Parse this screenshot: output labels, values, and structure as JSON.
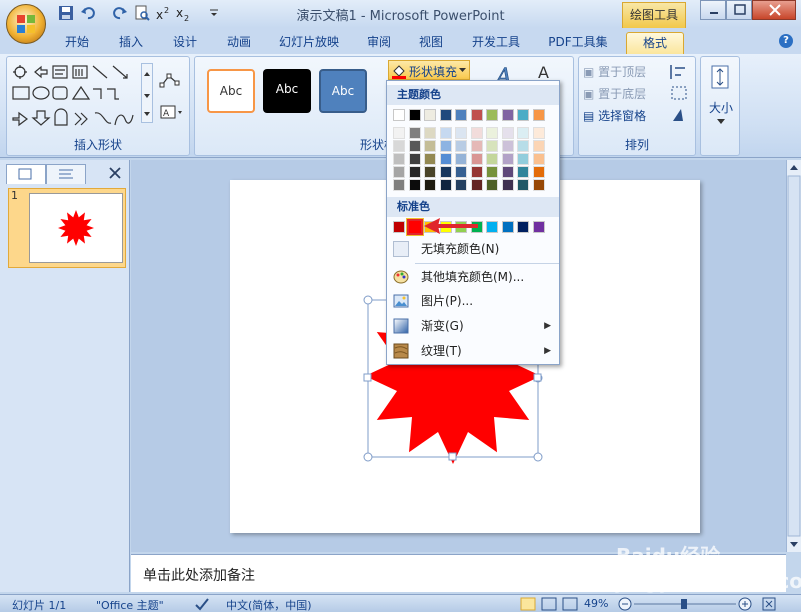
{
  "window": {
    "title": "演示文稿1 - Microsoft PowerPoint",
    "context_tab": "绘图工具"
  },
  "tabs": [
    {
      "label": "开始"
    },
    {
      "label": "插入"
    },
    {
      "label": "设计"
    },
    {
      "label": "动画"
    },
    {
      "label": "幻灯片放映"
    },
    {
      "label": "审阅"
    },
    {
      "label": "视图"
    },
    {
      "label": "开发工具"
    },
    {
      "label": "PDF工具集"
    },
    {
      "label": "格式"
    }
  ],
  "ribbon": {
    "group_insert_shapes": "插入形状",
    "group_shape_styles": "形状样式",
    "group_arrange": "排列",
    "style_sample": "Abc",
    "fill_button": "形状填充",
    "bring_front": "置于顶层",
    "send_back": "置于底层",
    "selection_pane": "选择窗格",
    "size": "大小"
  },
  "fill_menu": {
    "theme_colors_heading": "主题颜色",
    "standard_colors_heading": "标准色",
    "no_fill": "无填充颜色(N)",
    "more_colors": "其他填充颜色(M)...",
    "picture": "图片(P)...",
    "gradient": "渐变(G)",
    "texture": "纹理(T)",
    "theme_top_row": [
      "#ffffff",
      "#000000",
      "#eeece1",
      "#1f497d",
      "#4f81bd",
      "#c0504d",
      "#9bbb59",
      "#8064a2",
      "#4bacc6",
      "#f79646"
    ],
    "theme_shades": [
      [
        "#f2f2f2",
        "#d8d8d8",
        "#bfbfbf",
        "#a5a5a5",
        "#7f7f7f"
      ],
      [
        "#7f7f7f",
        "#595959",
        "#3f3f3f",
        "#262626",
        "#0c0c0c"
      ],
      [
        "#ddd9c3",
        "#c4bd97",
        "#938953",
        "#494429",
        "#1d1b10"
      ],
      [
        "#c6d9f0",
        "#8db3e2",
        "#548dd4",
        "#17365d",
        "#0f243e"
      ],
      [
        "#dbe5f1",
        "#b8cce4",
        "#95b3d7",
        "#366092",
        "#244061"
      ],
      [
        "#f2dcdb",
        "#e5b9b7",
        "#d99694",
        "#953734",
        "#632423"
      ],
      [
        "#ebf1dd",
        "#d7e3bc",
        "#c3d69b",
        "#76923c",
        "#4f6128"
      ],
      [
        "#e5e0ec",
        "#ccc1d9",
        "#b2a2c7",
        "#5f497a",
        "#3f3151"
      ],
      [
        "#dbeef3",
        "#b7dde8",
        "#92cddc",
        "#31859b",
        "#205867"
      ],
      [
        "#fdeada",
        "#fbd5b5",
        "#fac08f",
        "#e36c09",
        "#974806"
      ]
    ],
    "standard_colors": [
      "#c00000",
      "#ff0000",
      "#ffc000",
      "#ffff00",
      "#92d050",
      "#00b050",
      "#00b0f0",
      "#0070c0",
      "#002060",
      "#7030a0"
    ],
    "highlight_color": "#e0262c"
  },
  "slide_panel": {
    "slide_number": "1"
  },
  "notes": {
    "placeholder": "单击此处添加备注"
  },
  "status": {
    "slide_info": "幻灯片 1/1",
    "theme": "\"Office 主题\"",
    "language": "中文(简体，中国)",
    "zoom": "49%"
  },
  "shape": {
    "fill_color": "#ff0000"
  },
  "watermark": "Baidu经验 jingyan.baidu.com"
}
